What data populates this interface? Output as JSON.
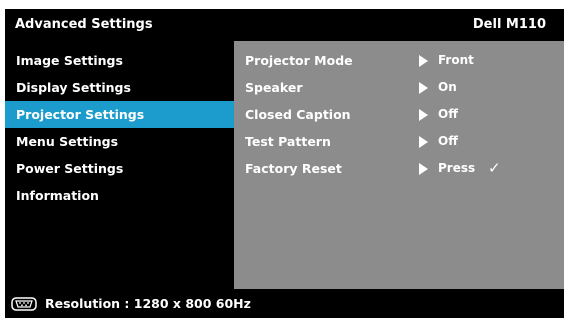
{
  "header": {
    "title": "Advanced Settings",
    "model": "Dell M110"
  },
  "menu": {
    "items": [
      {
        "label": "Image Settings"
      },
      {
        "label": "Display Settings"
      },
      {
        "label": "Projector Settings",
        "active": true
      },
      {
        "label": "Menu Settings"
      },
      {
        "label": "Power Settings"
      },
      {
        "label": "Information"
      }
    ]
  },
  "panel": {
    "rows": [
      {
        "label": "Projector Mode",
        "value": "Front"
      },
      {
        "label": "Speaker",
        "value": "On"
      },
      {
        "label": "Closed Caption",
        "value": "Off"
      },
      {
        "label": "Test Pattern",
        "value": "Off"
      },
      {
        "label": "Factory Reset",
        "value": "Press"
      }
    ]
  },
  "status": {
    "icon": "vga-connector-icon",
    "resolution_text": "Resolution : 1280 x 800 60Hz"
  },
  "colors": {
    "osd_background": "#000000",
    "highlight": "#1c9ccc",
    "panel_background": "#8c8c8c",
    "text": "#ffffff"
  }
}
